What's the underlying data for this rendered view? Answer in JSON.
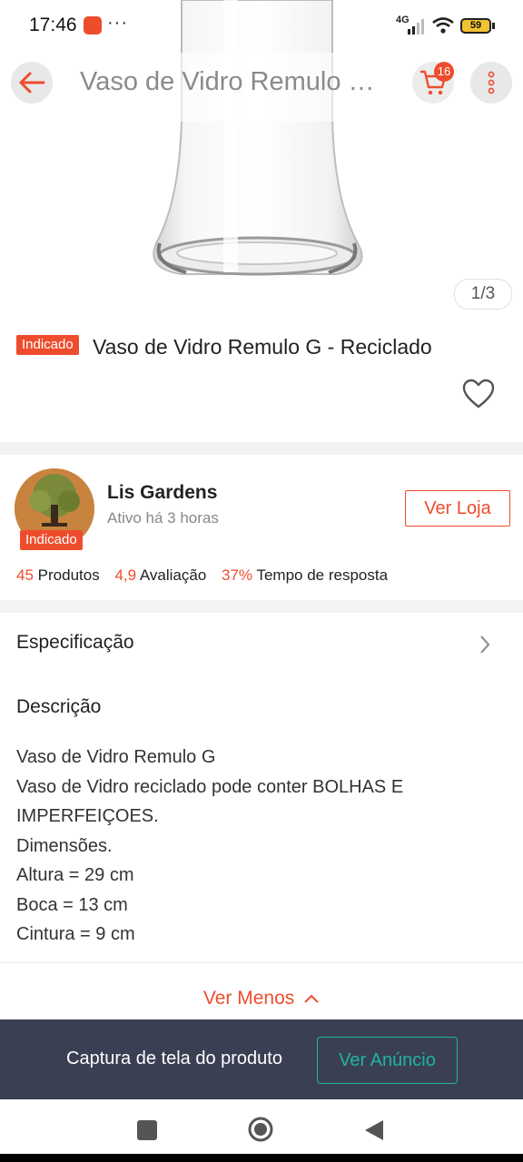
{
  "status_bar": {
    "time": "17:46",
    "dots": "···",
    "network": "4G",
    "battery": "59"
  },
  "app_bar": {
    "title": "Vaso de Vidro Remulo G - Reciclado",
    "cart_count": "16",
    "back_icon": "arrow-left-icon",
    "cart_icon": "cart-icon",
    "more_icon": "more-vertical-icon"
  },
  "gallery": {
    "counter": "1/3"
  },
  "product": {
    "badge": "Indicado",
    "title": "Vaso de Vidro Remulo G - Reciclado",
    "favorite_icon": "heart-icon"
  },
  "shop": {
    "name": "Lis Gardens",
    "active": "Ativo há 3 horas",
    "badge": "Indicado",
    "view_button": "Ver Loja",
    "stats": {
      "products_count": "45",
      "products_label": "Produtos",
      "rating": "4,9",
      "rating_label": "Avaliação",
      "response_rate": "37%",
      "response_label": "Tempo de resposta"
    }
  },
  "specification": {
    "label": "Especificação"
  },
  "description": {
    "label": "Descrição",
    "lines": [
      "Vaso de Vidro Remulo G",
      "Vaso de Vidro reciclado pode conter BOLHAS E",
      "IMPERFEIÇOES.",
      "Dimensões.",
      "Altura = 29 cm",
      "Boca = 13 cm",
      "Cintura = 9 cm"
    ],
    "toggle": "Ver Menos"
  },
  "capture_bar": {
    "text": "Captura de tela do produto",
    "button": "Ver Anúncio"
  },
  "colors": {
    "accent": "#ee4d2d",
    "capture_bar": "#3a3f54",
    "capture_button": "#20b59c"
  }
}
